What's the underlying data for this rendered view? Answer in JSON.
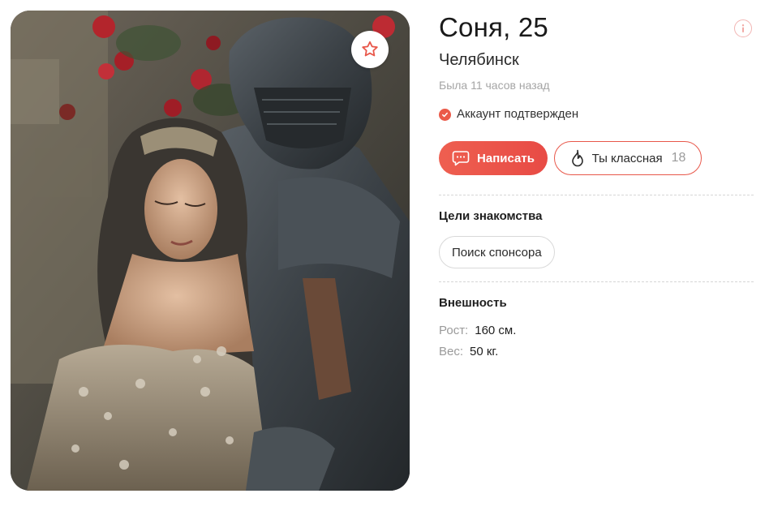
{
  "profile": {
    "name_age": "Соня, 25",
    "city": "Челябинск",
    "last_seen": "Была 11 часов назад",
    "verified_label": "Аккаунт подтвержден"
  },
  "actions": {
    "write_label": "Написать",
    "like_label": "Ты классная",
    "like_count": "18"
  },
  "goals": {
    "title": "Цели знакомства",
    "items": [
      "Поиск спонсора"
    ]
  },
  "appearance": {
    "title": "Внешность",
    "height_label": "Рост:",
    "height_value": "160 см.",
    "weight_label": "Вес:",
    "weight_value": "50 кг."
  },
  "icons": {
    "favorite": "star-icon",
    "info": "info-icon",
    "verified": "check-icon",
    "write": "chat-bubble-icon",
    "like": "flame-icon"
  },
  "colors": {
    "accent": "#eb5a49",
    "accent_border": "#e8574a",
    "muted_text": "#a5a5a5",
    "divider": "#d6d6d6"
  }
}
